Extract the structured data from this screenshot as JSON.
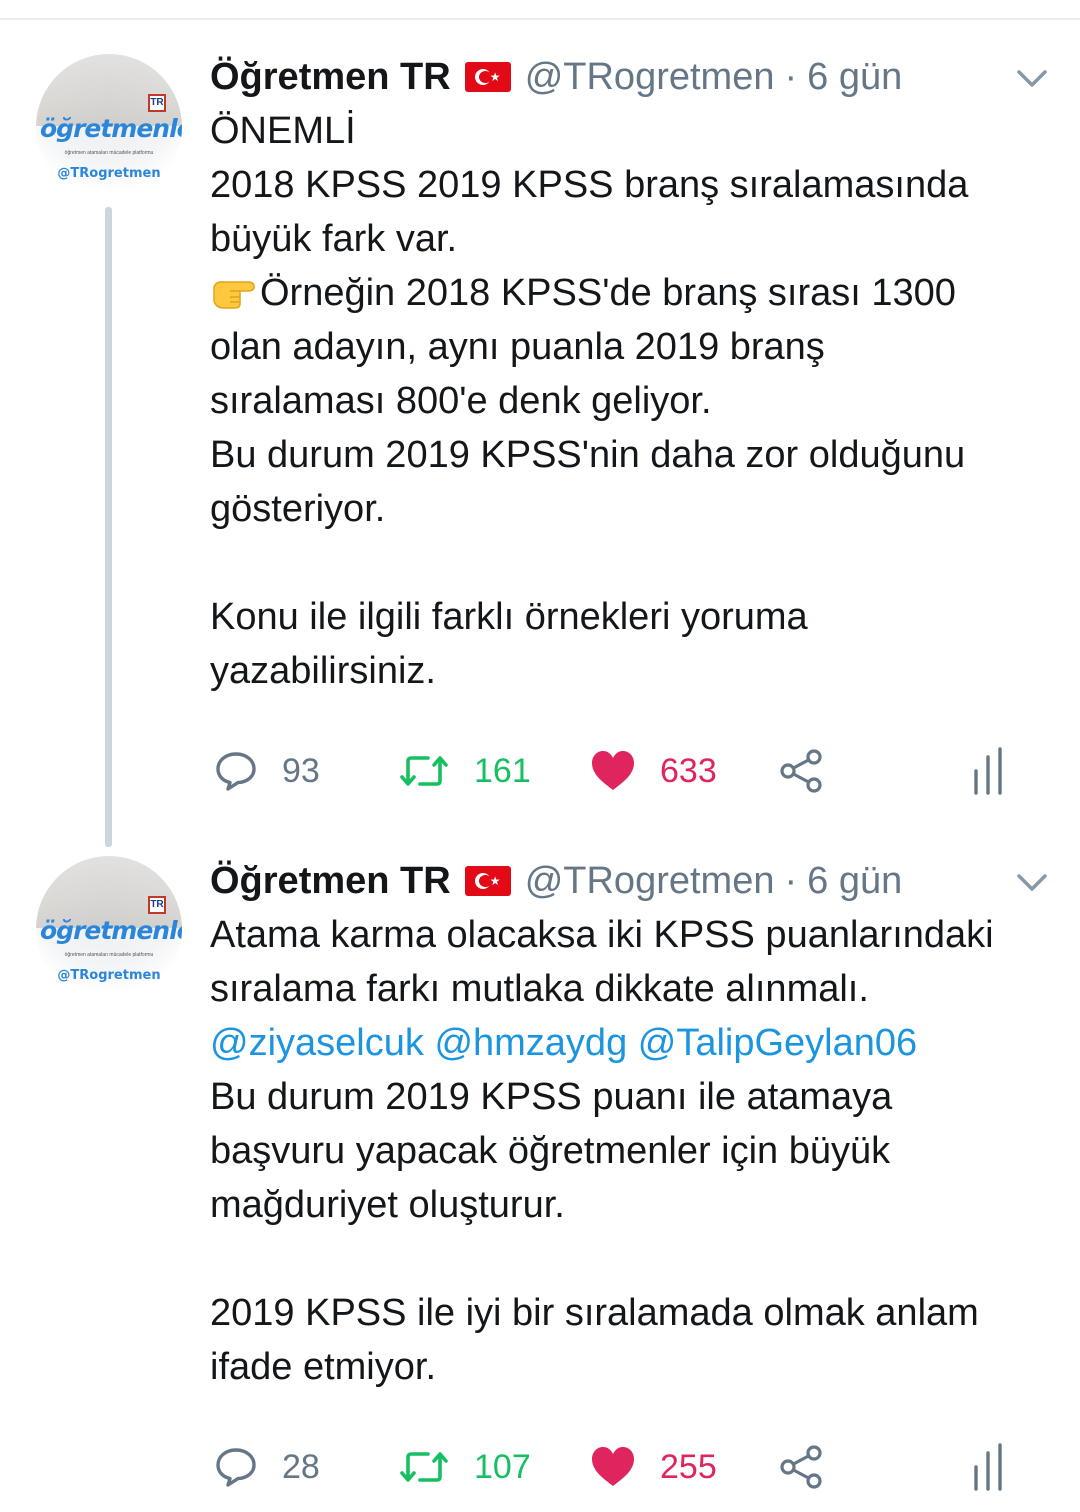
{
  "tweets": [
    {
      "author_name": "Öğretmen TR",
      "handle": "@TRogretmen",
      "separator": "·",
      "time": "6 gün",
      "avatar": {
        "logo_text": "öğretmenler",
        "slogan": "öğretmen atamaları mücadele platformu",
        "handle_text": "@TRogretmen",
        "mark": "TR"
      },
      "lines": [
        "ÖNEMLİ",
        "2018 KPSS 2019 KPSS branş sıralamasında",
        "büyük fark var.",
        "Örneğin 2018 KPSS'de branş sırası 1300",
        "olan adayın, aynı puanla 2019 branş",
        "sıralaması 800'e denk geliyor.",
        "Bu durum 2019 KPSS'nin daha zor olduğunu",
        "gösteriyor.",
        "",
        "Konu ile ilgili farklı örnekleri yoruma",
        "yazabilirsiniz."
      ],
      "replies": "93",
      "retweets": "161",
      "likes": "633"
    },
    {
      "author_name": "Öğretmen TR",
      "handle": "@TRogretmen",
      "separator": "·",
      "time": "6 gün",
      "avatar": {
        "logo_text": "öğretmenler",
        "slogan": "öğretmen atamaları mücadele platformu",
        "handle_text": "@TRogretmen",
        "mark": "TR"
      },
      "lines": [
        "Atama karma olacaksa iki KPSS puanlarındaki",
        "sıralama farkı mutlaka dikkate alınmalı.",
        "",
        "Bu durum 2019 KPSS puanı ile atamaya",
        "başvuru yapacak öğretmenler için büyük",
        "mağduriyet oluşturur.",
        "",
        "2019 KPSS ile iyi bir sıralamada olmak anlam",
        "ifade etmiyor."
      ],
      "mentions": [
        "@ziyaselcuk",
        "@hmzaydg",
        "@TalipGeylan06"
      ],
      "replies": "28",
      "retweets": "107",
      "likes": "255"
    }
  ],
  "icons": {
    "caret": "chevron-down-icon",
    "flag": "turkey-flag-icon",
    "pointer": "pointing-hand-emoji-icon",
    "reply": "reply-bubble-icon",
    "retweet": "retweet-icon",
    "like": "heart-icon",
    "share": "share-icon",
    "analytics": "analytics-bars-icon"
  },
  "colors": {
    "text": "#14171a",
    "muted": "#657786",
    "link": "#1b95e0",
    "retweet": "#17bf63",
    "like": "#e0245e",
    "divider": "#e6ecf0"
  }
}
